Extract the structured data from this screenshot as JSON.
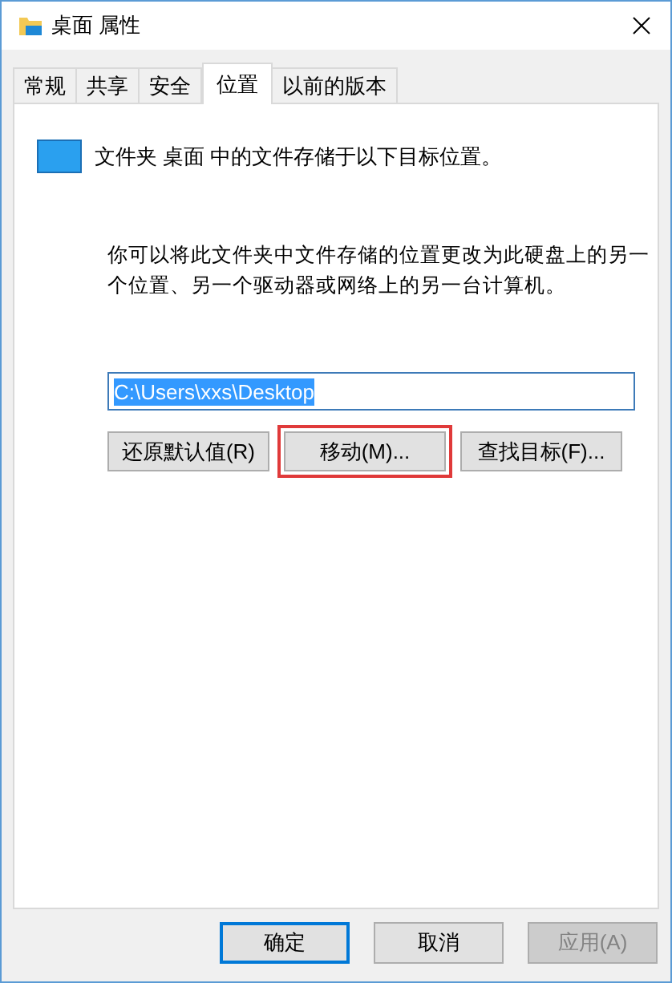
{
  "window": {
    "title": "桌面 属性"
  },
  "tabs": [
    {
      "label": "常规",
      "selected": false
    },
    {
      "label": "共享",
      "selected": false
    },
    {
      "label": "安全",
      "selected": false
    },
    {
      "label": "位置",
      "selected": true
    },
    {
      "label": "以前的版本",
      "selected": false
    }
  ],
  "location": {
    "heading": "文件夹 桌面 中的文件存储于以下目标位置。",
    "description": "你可以将此文件夹中文件存储的位置更改为此硬盘上的另一个位置、另一个驱动器或网络上的另一台计算机。",
    "path": {
      "value": "C:\\Users\\xxs\\Desktop",
      "selected": true
    },
    "buttons": [
      {
        "label": "还原默认值(R)",
        "highlighted": false
      },
      {
        "label": "移动(M)...",
        "highlighted": true
      },
      {
        "label": "查找目标(F)...",
        "highlighted": false
      }
    ]
  },
  "dialog_buttons": [
    {
      "label": "确定",
      "default": true,
      "disabled": false
    },
    {
      "label": "取消",
      "default": false,
      "disabled": false
    },
    {
      "label": "应用(A)",
      "default": false,
      "disabled": true
    }
  ]
}
